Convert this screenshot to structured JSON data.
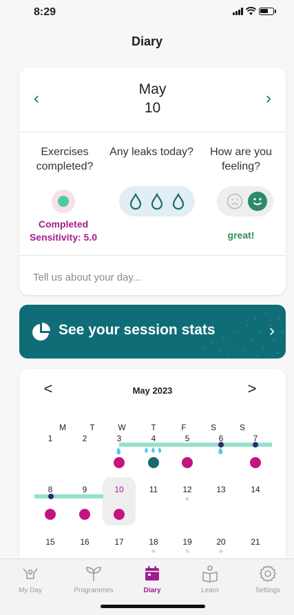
{
  "status_bar": {
    "time": "8:29"
  },
  "page": {
    "title": "Diary"
  },
  "diary_card": {
    "month": "May",
    "day": "10",
    "prev_glyph": "‹",
    "next_glyph": "›",
    "exercises_question": "Exercises completed?",
    "leaks_question": "Any leaks today?",
    "feeling_question": "How are you feeling?",
    "exercise_status_line1": "Completed",
    "exercise_status_line2": "Sensitivity: 5.0",
    "leak_icon_count": 3,
    "feeling_value": "great!",
    "note_placeholder": "Tell us about your day...",
    "colors": {
      "accent": "#a21d8f",
      "nav": "#1f6f6b",
      "green": "#2e8b68"
    }
  },
  "stats_banner": {
    "label": "See your session stats",
    "chevron": "›",
    "color": "#0f6d78"
  },
  "calendar": {
    "title": "May 2023",
    "prev_glyph": "<",
    "next_glyph": ">",
    "weekdays": [
      "M",
      "T",
      "W",
      "T",
      "F",
      "S",
      "S"
    ],
    "weeks": [
      [
        "1",
        "2",
        "3",
        "4",
        "5",
        "6",
        "7"
      ],
      [
        "8",
        "9",
        "10",
        "11",
        "12",
        "13",
        "14"
      ],
      [
        "15",
        "16",
        "17",
        "18",
        "19",
        "20",
        "21"
      ]
    ],
    "selected_day": "10"
  },
  "tab_bar": {
    "items": [
      {
        "label": "My Day",
        "icon": "hands-icon"
      },
      {
        "label": "Programmes",
        "icon": "sprout-icon"
      },
      {
        "label": "Diary",
        "icon": "calendar-icon",
        "active": true
      },
      {
        "label": "Learn",
        "icon": "book-icon"
      },
      {
        "label": "Settings",
        "icon": "gear-icon"
      }
    ],
    "active_color": "#a21d8f"
  }
}
